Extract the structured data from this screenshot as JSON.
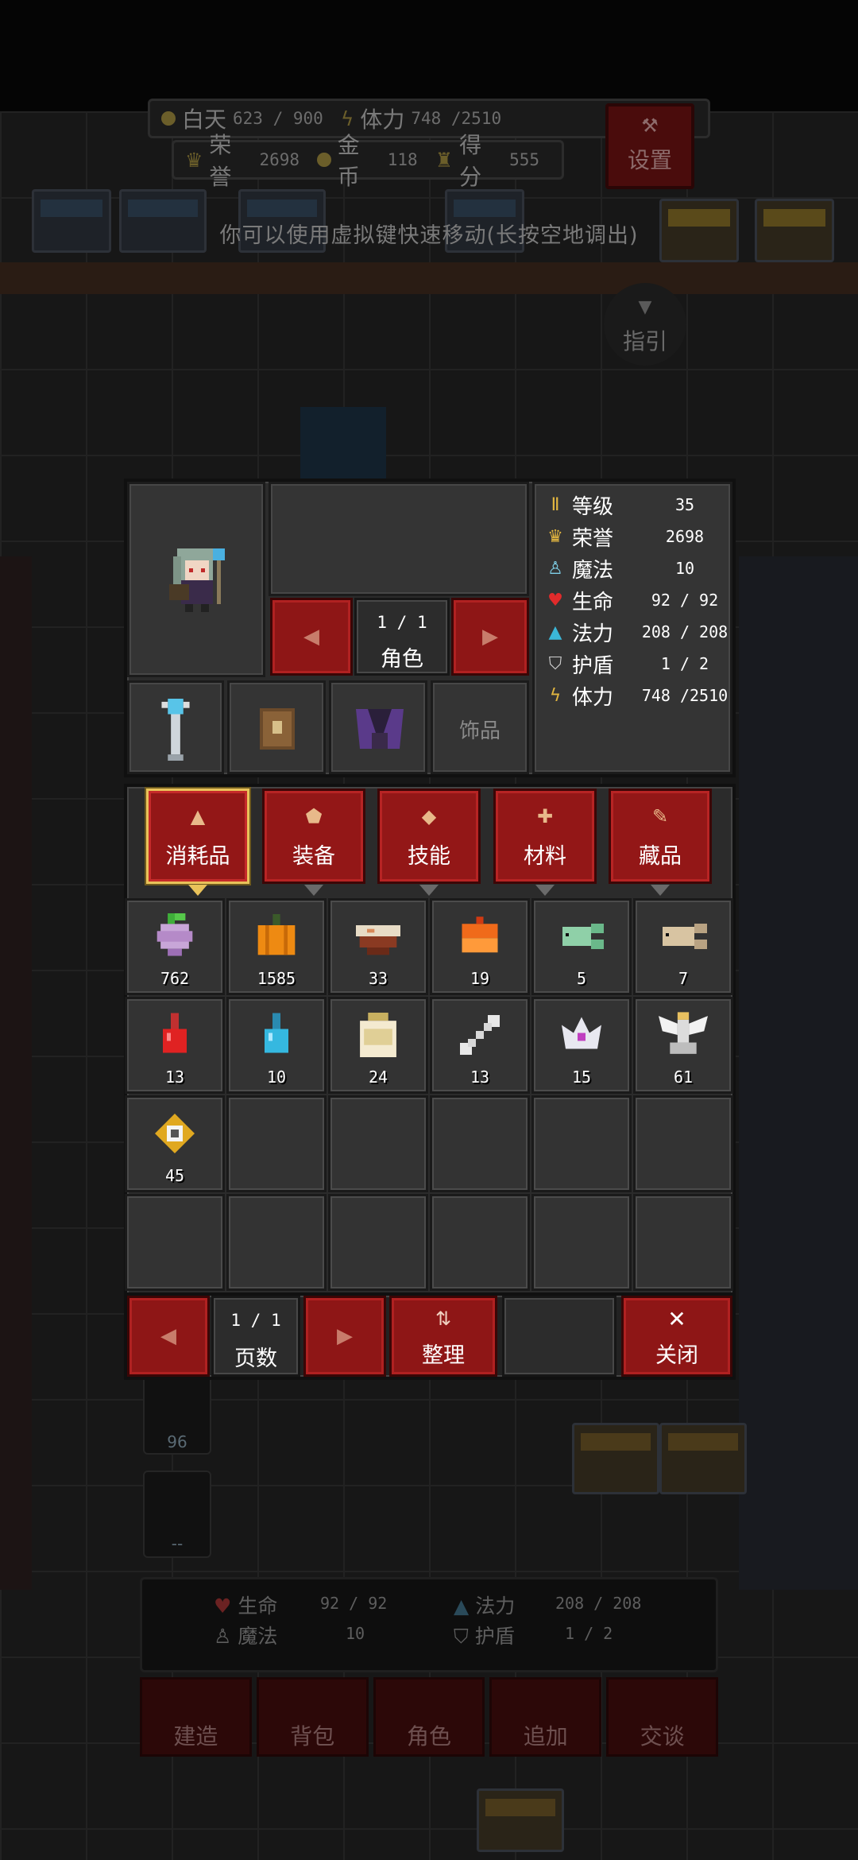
{
  "hud": {
    "daytime_label": "白天",
    "daytime_value": "623 / 900",
    "stamina_label": "体力",
    "stamina_value": "748 /2510",
    "honor_label": "荣誉",
    "honor_value": "2698",
    "gold_label": "金币",
    "gold_value": "118",
    "score_label": "得分",
    "score_value": "555",
    "settings_label": "设置",
    "guide_label": "指引",
    "hint": "你可以使用虚拟键快速移动(长按空地调出)"
  },
  "character": {
    "page": "1 / 1",
    "page_label": "角色",
    "accessory_label": "饰品",
    "stats": [
      {
        "label": "等级",
        "value": "35",
        "icon": "level-icon"
      },
      {
        "label": "荣誉",
        "value": "2698",
        "icon": "crown-icon"
      },
      {
        "label": "魔法",
        "value": "10",
        "icon": "magic-icon"
      },
      {
        "label": "生命",
        "value": "92 / 92",
        "icon": "heart-icon"
      },
      {
        "label": "法力",
        "value": "208 / 208",
        "icon": "mana-potion-icon"
      },
      {
        "label": "护盾",
        "value": "1 / 2",
        "icon": "shield-icon"
      },
      {
        "label": "体力",
        "value": "748 /2510",
        "icon": "lightning-icon"
      }
    ]
  },
  "tabs": [
    {
      "label": "消耗品",
      "icon": "flask-icon",
      "active": true
    },
    {
      "label": "装备",
      "icon": "armor-icon",
      "active": false
    },
    {
      "label": "技能",
      "icon": "diamond-icon",
      "active": false
    },
    {
      "label": "材料",
      "icon": "cross-icon",
      "active": false
    },
    {
      "label": "藏品",
      "icon": "scroll-icon",
      "active": false
    }
  ],
  "items": [
    {
      "name": "turnip",
      "count": "762"
    },
    {
      "name": "pumpkin",
      "count": "1585"
    },
    {
      "name": "soup-bowl",
      "count": "33"
    },
    {
      "name": "cake",
      "count": "19"
    },
    {
      "name": "green-fish",
      "count": "5"
    },
    {
      "name": "brown-fish",
      "count": "7"
    },
    {
      "name": "red-potion",
      "count": "13"
    },
    {
      "name": "blue-potion",
      "count": "10"
    },
    {
      "name": "milk-jar",
      "count": "24"
    },
    {
      "name": "bone",
      "count": "13"
    },
    {
      "name": "crown-gem",
      "count": "15"
    },
    {
      "name": "angel-statue",
      "count": "61"
    },
    {
      "name": "gold-compass",
      "count": "45"
    }
  ],
  "footer": {
    "page": "1 / 1",
    "page_label": "页数",
    "sort_label": "整理",
    "close_label": "关闭"
  },
  "bottom_status": {
    "hp_label": "生命",
    "hp_value": "92 / 92",
    "mp_label": "法力",
    "mp_value": "208 / 208",
    "magic_label": "魔法",
    "magic_value": "10",
    "shield_label": "护盾",
    "shield_value": "1 / 2",
    "side_value_1": "96",
    "side_value_2": "--"
  },
  "bottom_nav": [
    "建造",
    "背包",
    "角色",
    "追加",
    "交谈"
  ]
}
